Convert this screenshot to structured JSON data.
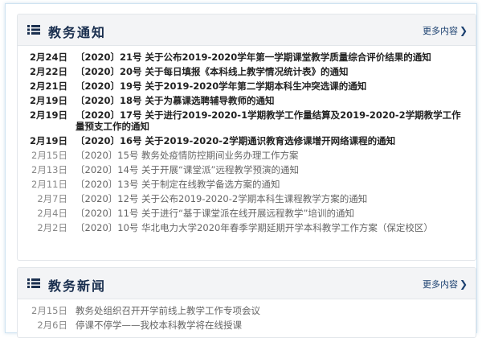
{
  "notice": {
    "title": "教务通知",
    "more": "更多内容",
    "items": [
      {
        "date": "2月24日",
        "title": "〔2020〕21号 关于公布2019-2020学年第一学期课堂教学质量综合评价结果的通知",
        "bold": true
      },
      {
        "date": "2月22日",
        "title": "〔2020〕20号 关于每日填报《本科线上教学情况统计表》的通知",
        "bold": true
      },
      {
        "date": "2月21日",
        "title": "〔2020〕19号 关于2019-2020学年第二学期本科生冲突选课的通知",
        "bold": true
      },
      {
        "date": "2月19日",
        "title": "〔2020〕18号 关于为慕课选聘辅导教师的通知",
        "bold": true
      },
      {
        "date": "2月19日",
        "title": "〔2020〕17号 关于进行2019-2020-1学期教学工作量结算及2019-2020-2学期教学工作量预支工作的通知",
        "bold": true
      },
      {
        "date": "2月19日",
        "title": "〔2020〕16号 关于2019-2020-2学期通识教育选修课增开网络课程的通知",
        "bold": true
      },
      {
        "date": "2月15日",
        "title": "〔2020〕15号 教务处疫情防控期间业务办理工作方案",
        "bold": false
      },
      {
        "date": "2月13日",
        "title": "〔2020〕14号 关于开展“课堂派”远程教学预演的通知",
        "bold": false
      },
      {
        "date": "2月11日",
        "title": "〔2020〕13号 关于制定在线教学备选方案的通知",
        "bold": false
      },
      {
        "date": "2月7日",
        "title": "〔2020〕12号 关于公布2019-2020-2学期本科生课程教学方案的通知",
        "bold": false
      },
      {
        "date": "2月4日",
        "title": "〔2020〕11号 关于进行“基于课堂派在线开展远程教学”培训的通知",
        "bold": false
      },
      {
        "date": "2月2日",
        "title": "〔2020〕10号 华北电力大学2020年春季学期延期开学本科教学工作方案（保定校区）",
        "bold": false
      }
    ]
  },
  "news": {
    "title": "教务新闻",
    "more": "更多内容",
    "items": [
      {
        "date": "2月15日",
        "title": "教务处组织召开开学前线上教学工作专项会议"
      },
      {
        "date": "2月6日",
        "title": "停课不停学——我校本科教学将在线授课"
      }
    ]
  },
  "icons": {
    "list": "list-icon",
    "more": "chevron-right-icon"
  },
  "colors": {
    "heading": "#1a2f4f",
    "link": "#1a3f6f"
  }
}
